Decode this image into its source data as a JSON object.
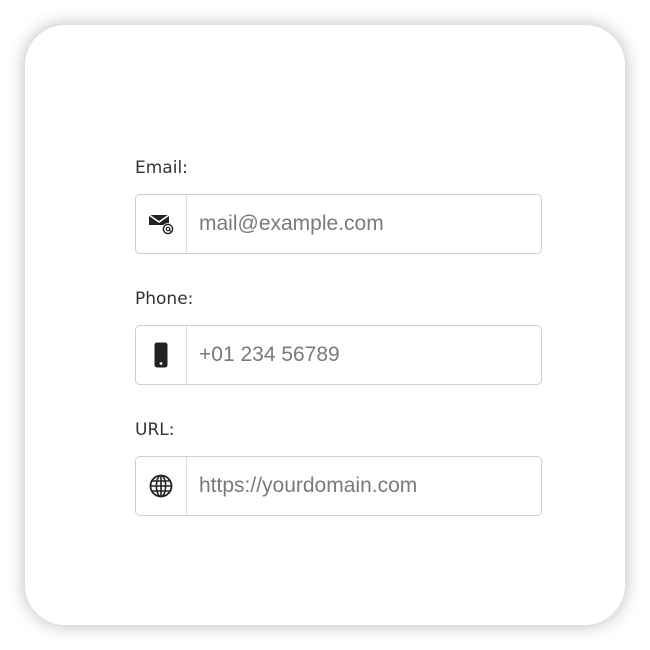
{
  "form": {
    "email": {
      "label": "Email:",
      "value": "",
      "placeholder": "mail@example.com",
      "icon": "envelope-at-icon"
    },
    "phone": {
      "label": "Phone:",
      "value": "",
      "placeholder": "+01 234 56789",
      "icon": "mobile-phone-icon"
    },
    "url": {
      "label": "URL:",
      "value": "",
      "placeholder": "https://yourdomain.com",
      "icon": "globe-icon"
    }
  },
  "colors": {
    "label_text": "#333333",
    "placeholder_text": "#7a7a7a",
    "border": "#cfcfcf",
    "icon": "#222222"
  }
}
